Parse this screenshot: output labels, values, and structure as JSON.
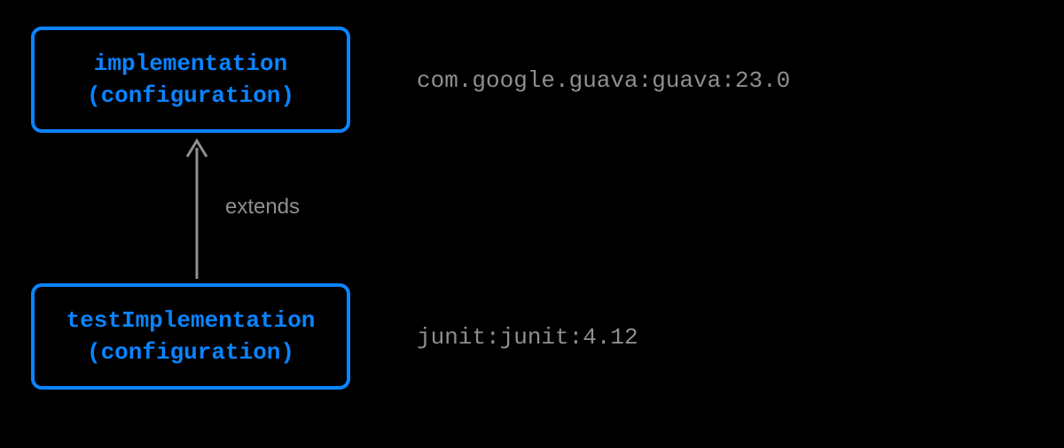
{
  "boxes": {
    "top": {
      "name": "implementation",
      "type": "(configuration)"
    },
    "bottom": {
      "name": "testImplementation",
      "type": "(configuration)"
    }
  },
  "dependencies": {
    "top": "com.google.guava:guava:23.0",
    "bottom": "junit:junit:4.12"
  },
  "relationship": {
    "label": "extends"
  },
  "colors": {
    "box_border": "#0a84ff",
    "box_text": "#0a84ff",
    "secondary_text": "#8e8e93",
    "background": "#000000"
  }
}
